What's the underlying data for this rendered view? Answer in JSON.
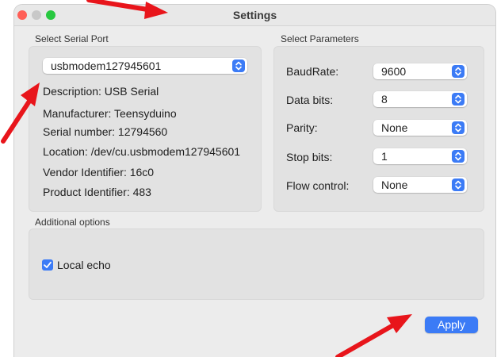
{
  "window": {
    "title": "Settings"
  },
  "serial_port": {
    "section_label": "Select Serial Port",
    "selected_port": "usbmodem127945601",
    "info": [
      "Description: USB Serial",
      "Manufacturer: Teensyduino",
      "Serial number: 12794560",
      "Location: /dev/cu.usbmodem127945601",
      "Vendor Identifier: 16c0",
      "Product Identifier: 483"
    ]
  },
  "parameters": {
    "section_label": "Select Parameters",
    "rows": [
      {
        "label": "BaudRate:",
        "value": "9600"
      },
      {
        "label": "Data bits:",
        "value": "8"
      },
      {
        "label": "Parity:",
        "value": "None"
      },
      {
        "label": "Stop bits:",
        "value": "1"
      },
      {
        "label": "Flow control:",
        "value": "None"
      }
    ]
  },
  "additional": {
    "section_label": "Additional options",
    "local_echo_label": "Local echo",
    "local_echo_checked": true
  },
  "apply_label": "Apply",
  "colors": {
    "accent": "#3b7bf6",
    "annotation_arrow": "#e8151b"
  },
  "icons": {
    "popup_stepper": "chevron-up-down-icon",
    "checkbox": "checkmark-icon",
    "annotation": "red-arrow"
  }
}
